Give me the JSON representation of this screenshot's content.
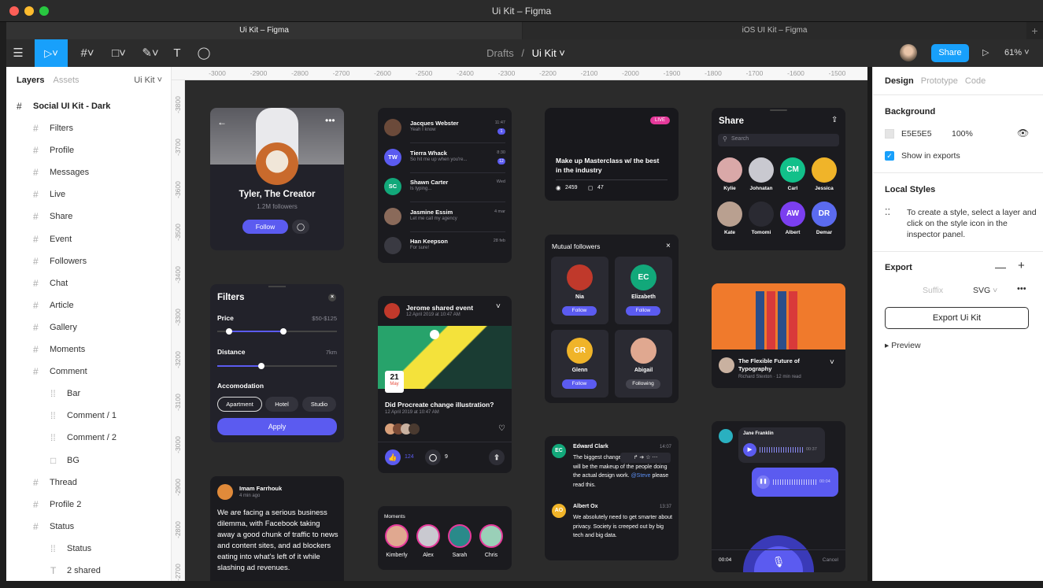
{
  "window": {
    "title": "Ui Kit – Figma"
  },
  "tabs": [
    {
      "label": "Ui Kit – Figma"
    },
    {
      "label": "iOS UI Kit – Figma"
    }
  ],
  "toolbar": {
    "breadcrumb_parent": "Drafts",
    "breadcrumb_sep": "/",
    "file_name": "Ui Kit",
    "share_label": "Share",
    "zoom": "61%"
  },
  "left_panel": {
    "tab_layers": "Layers",
    "tab_assets": "Assets",
    "page": "Ui Kit",
    "root": "Social UI Kit - Dark",
    "layers": [
      "Filters",
      "Profile",
      "Messages",
      "Live",
      "Share",
      "Event",
      "Followers",
      "Chat",
      "Article",
      "Gallery",
      "Moments",
      "Comment",
      "Bar",
      "Comment / 1",
      "Comment / 2",
      "BG",
      "Thread",
      "Profile 2",
      "Status",
      "Status",
      "2 shared"
    ]
  },
  "ruler": {
    "x": [
      "-3000",
      "-2900",
      "-2800",
      "-2700",
      "-2600",
      "-2500",
      "-2400",
      "-2300",
      "-2200",
      "-2100",
      "-2000",
      "-1900",
      "-1800",
      "-1700",
      "-1600",
      "-1500"
    ],
    "y": [
      "-3800",
      "-3700",
      "-3600",
      "-3500",
      "-3400",
      "-3300",
      "-3200",
      "-3100",
      "-3000",
      "-2900",
      "-2800",
      "-2700"
    ]
  },
  "right_panel": {
    "tab_design": "Design",
    "tab_prototype": "Prototype",
    "tab_code": "Code",
    "background_title": "Background",
    "bg_hex": "E5E5E5",
    "bg_opacity": "100%",
    "show_in_exports": "Show in exports",
    "local_styles_title": "Local Styles",
    "local_styles_hint": "To create a style, select a layer and click on the style icon in the inspector panel.",
    "export_title": "Export",
    "export_suffix": "Suffix",
    "export_format": "SVG",
    "export_button": "Export Ui Kit",
    "preview": "Preview"
  },
  "profile": {
    "name": "Tyler, The Creator",
    "followers": "1.2M followers",
    "follow": "Follow"
  },
  "messages": [
    {
      "name": "Jacques Webster",
      "text": "Yeah I know",
      "time": "11:47",
      "badge": "1",
      "initials": ""
    },
    {
      "name": "Tierra Whack",
      "text": "So hit me up when you're...",
      "time": "8:30",
      "badge": "12",
      "initials": "TW"
    },
    {
      "name": "Shawn Carter",
      "text": "Is typing...",
      "time": "Wed",
      "badge": "",
      "initials": "SC"
    },
    {
      "name": "Jasmine Essim",
      "text": "Let me call my agency",
      "time": "4 mar",
      "badge": "",
      "initials": ""
    },
    {
      "name": "Han Keepson",
      "text": "For sure!",
      "time": "28 feb",
      "badge": "",
      "initials": ""
    }
  ],
  "live": {
    "badge": "LIVE",
    "title": "Make up Masterclass w/ the best in the industry",
    "views": "2459",
    "comments": "47"
  },
  "share": {
    "title": "Share",
    "search_placeholder": "Search",
    "people": [
      {
        "name": "Kylie",
        "initials": ""
      },
      {
        "name": "Johnatan",
        "initials": ""
      },
      {
        "name": "Carl",
        "initials": "CM"
      },
      {
        "name": "Jessica",
        "initials": ""
      },
      {
        "name": "Kate",
        "initials": ""
      },
      {
        "name": "Tomomi",
        "initials": ""
      },
      {
        "name": "Albert",
        "initials": "AW"
      },
      {
        "name": "Demar",
        "initials": "DR"
      }
    ]
  },
  "filters": {
    "title": "Filters",
    "price_label": "Price",
    "price_value": "$50-$125",
    "distance_label": "Distance",
    "distance_value": "7km",
    "price_range": [
      0.1,
      0.55
    ],
    "distance_level": 0.37,
    "accommodation_label": "Accomodation",
    "options": [
      "Apartment",
      "Hotel",
      "Studio"
    ],
    "apply": "Apply"
  },
  "event": {
    "header": "Jerome shared event",
    "date_line": "12 April 2019 at 10:47 AM",
    "day": "21",
    "month": "May",
    "title": "Did Procreate change illustration?",
    "subdate": "12 April 2019 at 10:47 AM",
    "likes": "124",
    "comments": "9"
  },
  "followers": {
    "title": "Mutual followers",
    "people": [
      {
        "name": "Nia",
        "initials": "",
        "action": "Follow"
      },
      {
        "name": "Elizabeth",
        "initials": "EC",
        "action": "Follow"
      },
      {
        "name": "Glenn",
        "initials": "GR",
        "action": "Follow"
      },
      {
        "name": "Abigail",
        "initials": "",
        "action": "Following"
      }
    ]
  },
  "article": {
    "title": "The Flexible Future of Typography",
    "meta": "Richard Stexton · 12 min read"
  },
  "comment": {
    "name": "Imam Farrhouk",
    "time": "4 min ago",
    "text": "We are facing a serious business dilemma, with Facebook taking away a good chunk of traffic to news and content sites, and ad blockers eating into what's left of it while slashing ad revenues."
  },
  "moments": {
    "title": "Moments",
    "people": [
      "Kimberly",
      "Alex",
      "Sarah",
      "Chris"
    ]
  },
  "thread": [
    {
      "initials": "EC",
      "name": "Edward Clark",
      "time": "14:07",
      "text": "The biggest change in design in 2019 will be the makeup of the people doing the actual design work.",
      "mention": "@Steve",
      "mention_rest": " please read this."
    },
    {
      "initials": "AO",
      "name": "Albert Ox",
      "time": "13:37",
      "text": "We absolutely need to get smarter about privacy. Society is creeped out by big tech and big data."
    }
  ],
  "voice": {
    "name": "Jane Franklin",
    "time1": "00:37",
    "time2": "00:04",
    "elapsed": "00:04",
    "cancel": "Cancel"
  },
  "colors": {
    "accent": "#18a0fb",
    "purple": "#5b5bf0",
    "card": "#1b1b1f",
    "canvas": "#2b2b2b"
  }
}
